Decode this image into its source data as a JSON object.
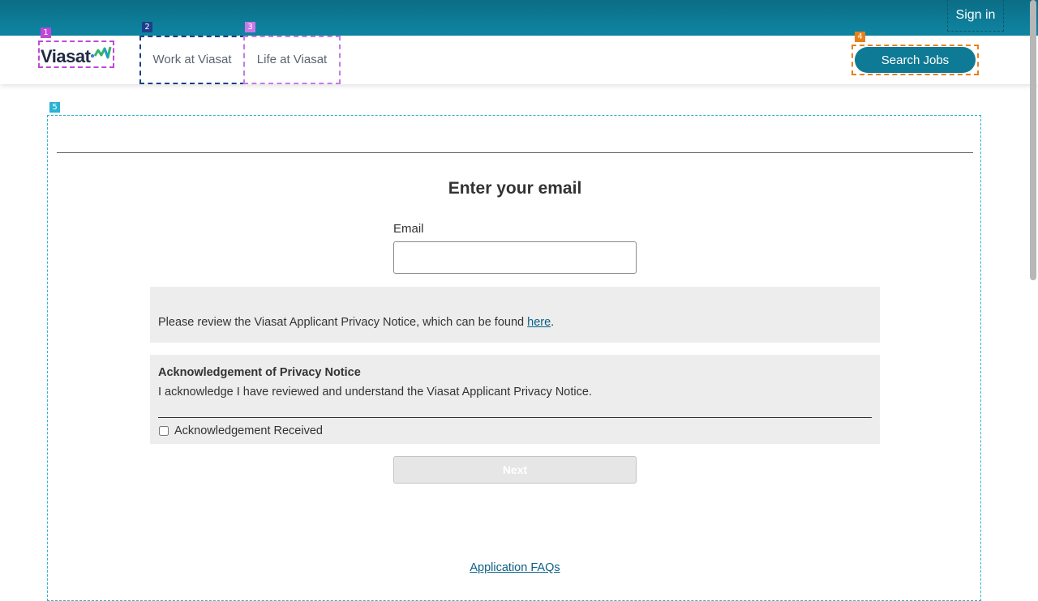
{
  "header": {
    "sign_in_label": "Sign in",
    "logo_text": "Viasat",
    "nav": [
      {
        "label": "Work at Viasat"
      },
      {
        "label": "Life at Viasat"
      }
    ],
    "search_jobs_label": "Search Jobs"
  },
  "markers": {
    "logo": "1",
    "work": "2",
    "life": "3",
    "search": "4",
    "main": "5"
  },
  "form": {
    "title": "Enter your email",
    "email_label": "Email",
    "email_value": "",
    "privacy_text": "Please review the Viasat Applicant Privacy Notice, which can be found ",
    "privacy_link": "here",
    "privacy_end": ".",
    "ack_title": "Acknowledgement of Privacy Notice",
    "ack_text": "I acknowledge I have reviewed and understand the Viasat Applicant Privacy Notice.",
    "ack_checkbox_label": "Acknowledgement Received",
    "ack_checked": false,
    "next_label": "Next",
    "faq_link": "Application FAQs"
  },
  "colors": {
    "brand_teal": "#0f7a95",
    "link": "#0b5f87",
    "marker_logo": "#c048d8",
    "marker_work": "#1d3f8a",
    "marker_life": "#c879e8",
    "marker_search": "#e8801a",
    "marker_main": "#2bb2d4"
  }
}
